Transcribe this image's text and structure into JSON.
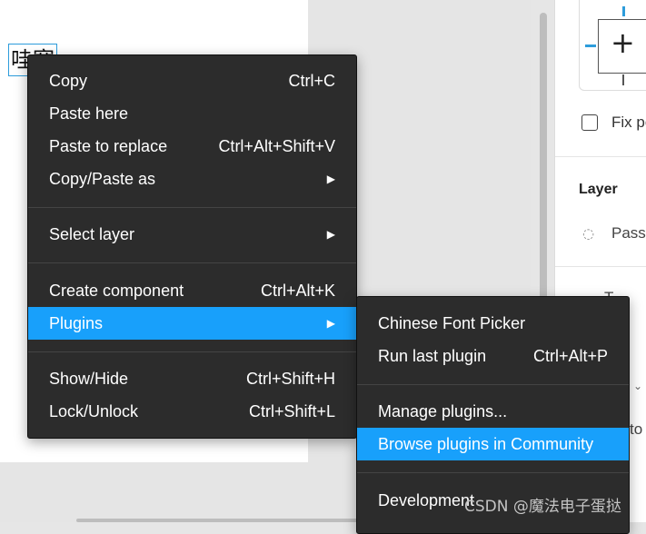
{
  "canvas": {
    "selected_text": "哇塞"
  },
  "context_menu": {
    "groups": [
      [
        {
          "label": "Copy",
          "shortcut": "Ctrl+C",
          "submenu": false
        },
        {
          "label": "Paste here",
          "shortcut": "",
          "submenu": false
        },
        {
          "label": "Paste to replace",
          "shortcut": "Ctrl+Alt+Shift+V",
          "submenu": false
        },
        {
          "label": "Copy/Paste as",
          "shortcut": "",
          "submenu": true
        }
      ],
      [
        {
          "label": "Select layer",
          "shortcut": "",
          "submenu": true
        }
      ],
      [
        {
          "label": "Create component",
          "shortcut": "Ctrl+Alt+K",
          "submenu": false
        },
        {
          "label": "Plugins",
          "shortcut": "",
          "submenu": true,
          "active": true
        }
      ],
      [
        {
          "label": "Show/Hide",
          "shortcut": "Ctrl+Shift+H",
          "submenu": false
        },
        {
          "label": "Lock/Unlock",
          "shortcut": "Ctrl+Shift+L",
          "submenu": false
        }
      ]
    ],
    "arrow_glyph": "▶"
  },
  "plugins_submenu": {
    "items": [
      {
        "label": "Chinese Font Picker",
        "shortcut": ""
      },
      {
        "label": "Run last plugin",
        "shortcut": "Ctrl+Alt+P"
      },
      {
        "label": "Manage plugins...",
        "shortcut": ""
      },
      {
        "label": "Browse plugins in Community",
        "shortcut": "",
        "active": true
      },
      {
        "label": "Development",
        "shortcut": ""
      }
    ]
  },
  "right_panel": {
    "fix_label": "Fix po",
    "layer_title": "Layer",
    "blend_label": "Pass",
    "blend_icon": "drop-icon",
    "cut_text_t": "T",
    "cut_text_to": "to"
  },
  "watermark": "CSDN @魔法电子蛋挞",
  "colors": {
    "menu_bg": "#2c2c2c",
    "menu_highlight": "#18a0fb",
    "selection_blue": "#2d9cdb"
  }
}
